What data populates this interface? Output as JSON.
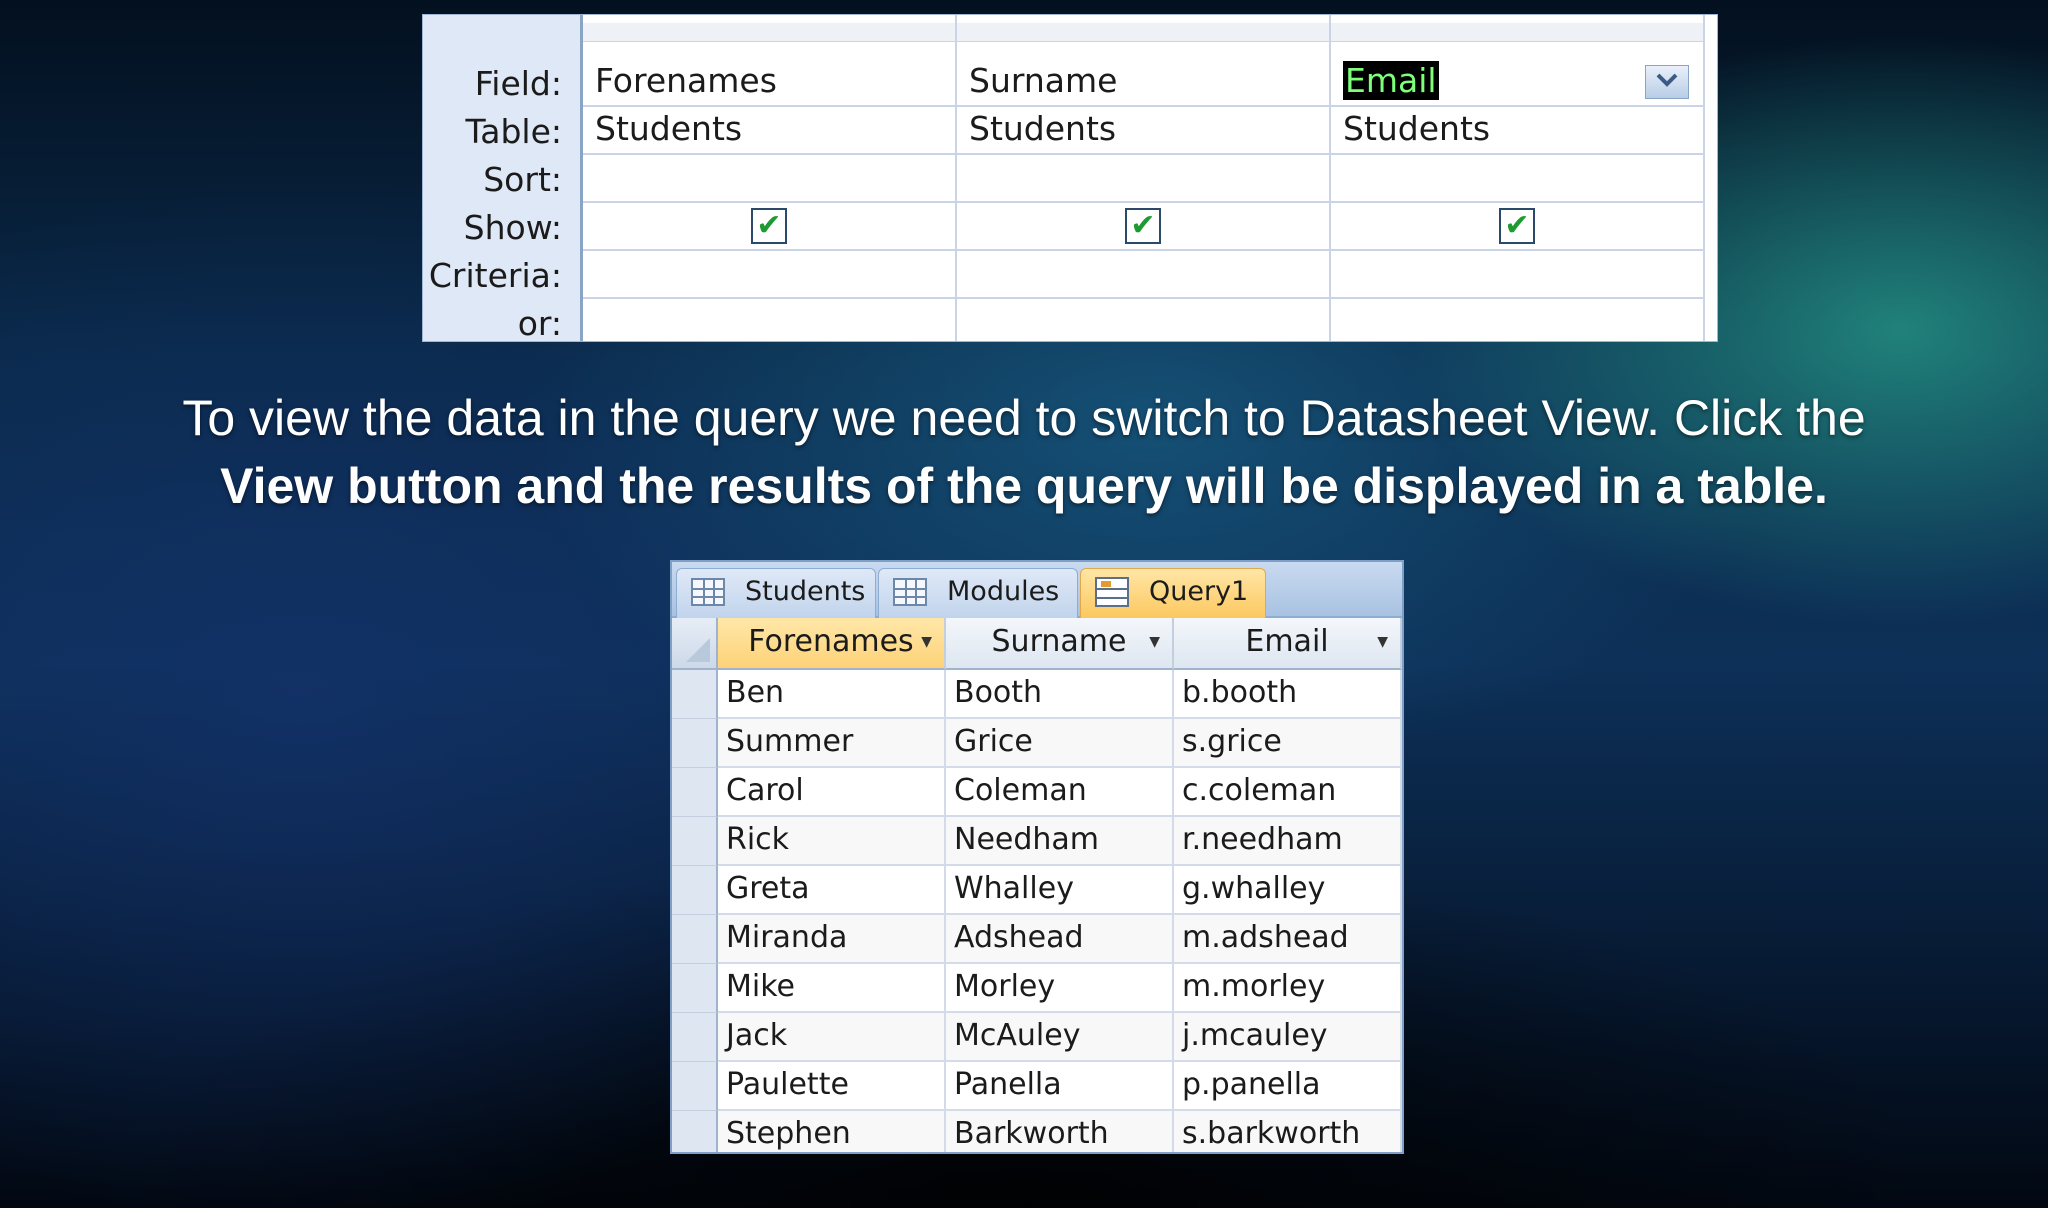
{
  "design_grid": {
    "row_labels": [
      "Field:",
      "Table:",
      "Sort:",
      "Show:",
      "Criteria:",
      "or:"
    ],
    "columns": [
      {
        "field": "Forenames",
        "table": "Students",
        "sort": "",
        "show": true,
        "criteria": "",
        "or": ""
      },
      {
        "field": "Surname",
        "table": "Students",
        "sort": "",
        "show": true,
        "criteria": "",
        "or": ""
      },
      {
        "field": "Email",
        "table": "Students",
        "sort": "",
        "show": true,
        "criteria": "",
        "or": ""
      }
    ],
    "dropdown_icon": "chevron-down-icon",
    "checkmark_glyph": "✔"
  },
  "caption": {
    "line1": "To view the data in the query we need to switch to Datasheet View. Click the",
    "line2": "View button and the results of the query will be displayed in a table."
  },
  "datasheet": {
    "tabs": [
      {
        "label": "Students",
        "icon": "table-icon",
        "active": false
      },
      {
        "label": "Modules",
        "icon": "table-icon",
        "active": false
      },
      {
        "label": "Query1",
        "icon": "query-icon",
        "active": true
      }
    ],
    "headers": [
      "Forenames",
      "Surname",
      "Email"
    ],
    "sort_arrow_glyph": "▼",
    "rows": [
      [
        "Ben",
        "Booth",
        "b.booth"
      ],
      [
        "Summer",
        "Grice",
        "s.grice"
      ],
      [
        "Carol",
        "Coleman",
        "c.coleman"
      ],
      [
        "Rick",
        "Needham",
        "r.needham"
      ],
      [
        "Greta",
        "Whalley",
        "g.whalley"
      ],
      [
        "Miranda",
        "Adshead",
        "m.adshead"
      ],
      [
        "Mike",
        "Morley",
        "m.morley"
      ],
      [
        "Jack",
        "McAuley",
        "j.mcauley"
      ],
      [
        "Paulette",
        "Panella",
        "p.panella"
      ],
      [
        "Stephen",
        "Barkworth",
        "s.barkworth"
      ]
    ]
  },
  "colors": {
    "accent_tab": "#fcc85f",
    "checkmark": "#1e9a32",
    "grid_label_bg": "#dfe8f6"
  }
}
